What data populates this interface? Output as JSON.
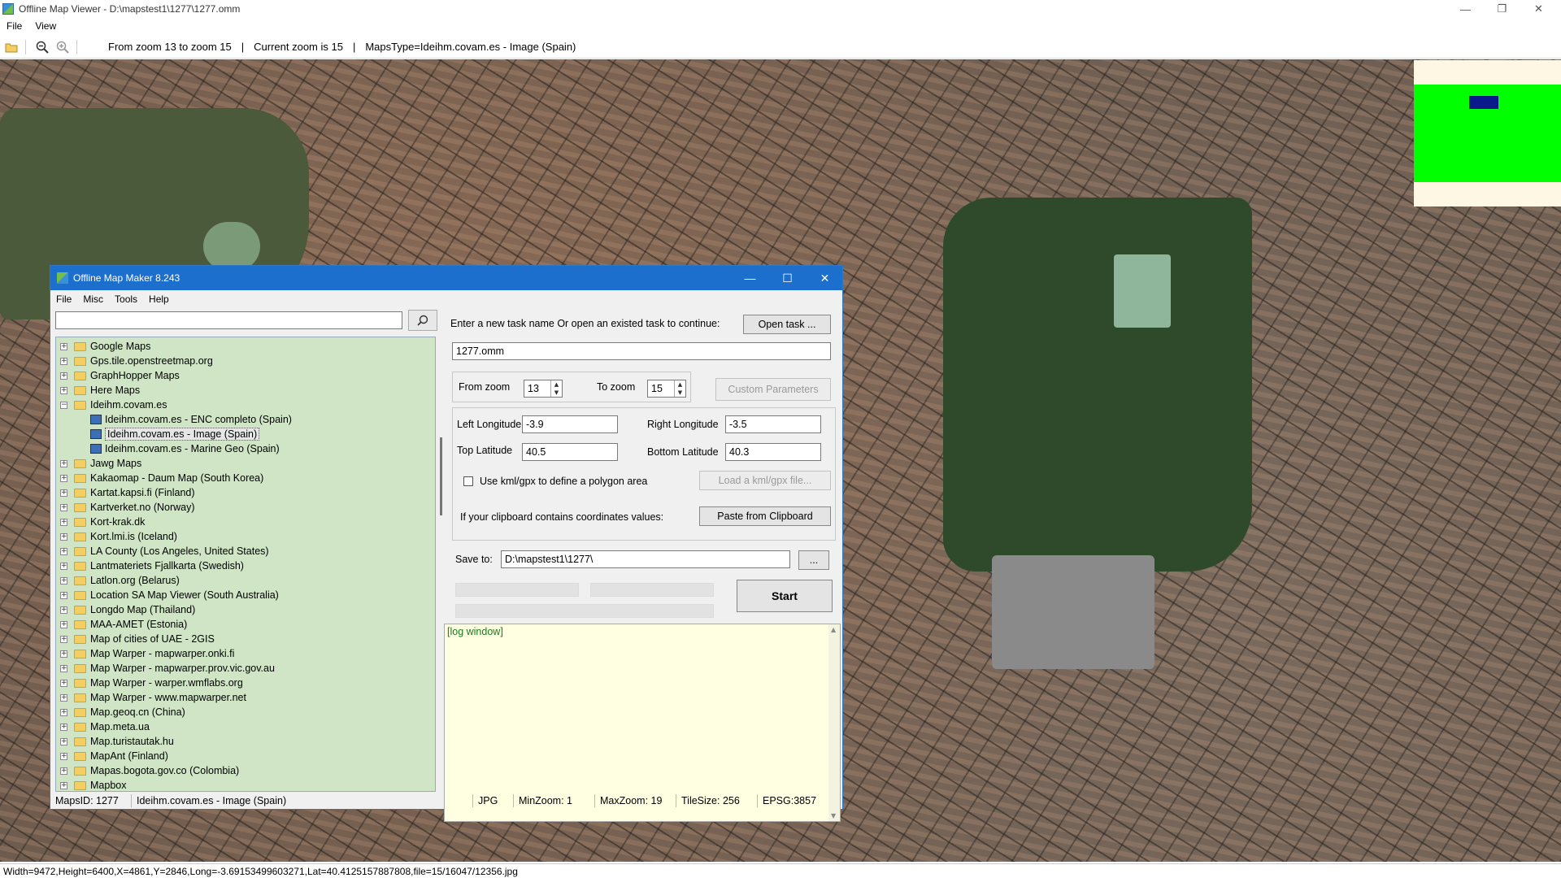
{
  "window": {
    "title": "Offline Map Viewer - D:\\mapstest1\\1277\\1277.omm",
    "controls": {
      "minimize": "—",
      "maximize": "❐",
      "close": "✕"
    }
  },
  "menu": [
    "File",
    "View"
  ],
  "toolbar": {
    "zoom_range": "From zoom 13 to zoom 15",
    "current_zoom": "Current zoom is 15",
    "maps_type": "MapsType=Ideihm.covam.es - Image (Spain)",
    "separator": "|"
  },
  "status_bar": "Width=9472,Height=6400,X=4861,Y=2846,Long=-3.69153499603271,Lat=40.4125157887808,file=15/16047/12356.jpg",
  "dialog": {
    "title": "Offline Map Maker 8.243",
    "controls": {
      "minimize": "—",
      "maximize": "☐",
      "close": "✕"
    },
    "menu": [
      "File",
      "Misc",
      "Tools",
      "Help"
    ],
    "search": {
      "value": "",
      "placeholder": ""
    },
    "tree": [
      {
        "label": "Google Maps",
        "level": 0,
        "expanded": false
      },
      {
        "label": "Gps.tile.openstreetmap.org",
        "level": 0,
        "expanded": false
      },
      {
        "label": "GraphHopper Maps",
        "level": 0,
        "expanded": false
      },
      {
        "label": "Here Maps",
        "level": 0,
        "expanded": false
      },
      {
        "label": "Ideihm.covam.es",
        "level": 0,
        "expanded": true
      },
      {
        "label": "Ideihm.covam.es - ENC completo (Spain)",
        "level": 1
      },
      {
        "label": "Ideihm.covam.es - Image (Spain)",
        "level": 1,
        "selected": true
      },
      {
        "label": "Ideihm.covam.es - Marine Geo (Spain)",
        "level": 1
      },
      {
        "label": "Jawg Maps",
        "level": 0,
        "expanded": false
      },
      {
        "label": "Kakaomap - Daum Map (South Korea)",
        "level": 0,
        "expanded": false
      },
      {
        "label": "Kartat.kapsi.fi (Finland)",
        "level": 0,
        "expanded": false
      },
      {
        "label": "Kartverket.no (Norway)",
        "level": 0,
        "expanded": false
      },
      {
        "label": "Kort-krak.dk",
        "level": 0,
        "expanded": false
      },
      {
        "label": "Kort.lmi.is (Iceland)",
        "level": 0,
        "expanded": false
      },
      {
        "label": "LA County (Los Angeles, United States)",
        "level": 0,
        "expanded": false
      },
      {
        "label": "Lantmateriets Fjallkarta (Swedish)",
        "level": 0,
        "expanded": false
      },
      {
        "label": "Latlon.org (Belarus)",
        "level": 0,
        "expanded": false
      },
      {
        "label": "Location SA Map Viewer (South Australia)",
        "level": 0,
        "expanded": false
      },
      {
        "label": "Longdo Map (Thailand)",
        "level": 0,
        "expanded": false
      },
      {
        "label": "MAA-AMET (Estonia)",
        "level": 0,
        "expanded": false
      },
      {
        "label": "Map of cities of UAE - 2GIS",
        "level": 0,
        "expanded": false
      },
      {
        "label": "Map Warper - mapwarper.onki.fi",
        "level": 0,
        "expanded": false
      },
      {
        "label": "Map Warper - mapwarper.prov.vic.gov.au",
        "level": 0,
        "expanded": false
      },
      {
        "label": "Map Warper - warper.wmflabs.org",
        "level": 0,
        "expanded": false
      },
      {
        "label": "Map Warper - www.mapwarper.net",
        "level": 0,
        "expanded": false
      },
      {
        "label": "Map.geoq.cn (China)",
        "level": 0,
        "expanded": false
      },
      {
        "label": "Map.meta.ua",
        "level": 0,
        "expanded": false
      },
      {
        "label": "Map.turistautak.hu",
        "level": 0,
        "expanded": false
      },
      {
        "label": "MapAnt (Finland)",
        "level": 0,
        "expanded": false
      },
      {
        "label": "Mapas.bogota.gov.co (Colombia)",
        "level": 0,
        "expanded": false
      },
      {
        "label": "Mapbox",
        "level": 0,
        "expanded": false
      }
    ],
    "task_prompt": "Enter a new task name Or open an existed task to continue:",
    "open_task_button": "Open task ...",
    "task_name": "1277.omm",
    "from_zoom_label": "From zoom",
    "from_zoom": "13",
    "to_zoom_label": "To zoom",
    "to_zoom": "15",
    "custom_params_button": "Custom Parameters",
    "left_longitude_label": "Left Longitude",
    "left_longitude": "-3.9",
    "right_longitude_label": "Right Longitude",
    "right_longitude": "-3.5",
    "top_latitude_label": "Top Latitude",
    "top_latitude": "40.5",
    "bottom_latitude_label": "Bottom Latitude",
    "bottom_latitude": "40.3",
    "kml_checkbox_label": "Use kml/gpx to define a polygon area",
    "kml_checked": false,
    "load_kml_button": "Load a kml/gpx file...",
    "clipboard_label": "If your clipboard contains coordinates values:",
    "paste_button": "Paste from Clipboard",
    "save_to_label": "Save to:",
    "save_to": "D:\\mapstest1\\1277\\",
    "browse_button": "...",
    "start_button": "Start",
    "log_text": "[log window]",
    "status": {
      "maps_id": "MapsID: 1277",
      "maps_name": "Ideihm.covam.es - Image (Spain)",
      "format": "JPG",
      "min_zoom": "MinZoom: 1",
      "max_zoom": "MaxZoom: 19",
      "tile_size": "TileSize: 256",
      "epsg": "EPSG:3857"
    }
  },
  "icons": {
    "open": "folder-open-icon",
    "zoom_out": "zoom-out-icon",
    "zoom_in": "zoom-in-icon",
    "search": "search-icon"
  },
  "colors": {
    "dialog_titlebar": "#1c6fcd",
    "tree_background": "#cfe5c5",
    "log_background": "#ffffe1",
    "log_text": "#1e7a1e",
    "minimap_green": "#00ff00",
    "minimap_view": "#0a1a8a"
  }
}
